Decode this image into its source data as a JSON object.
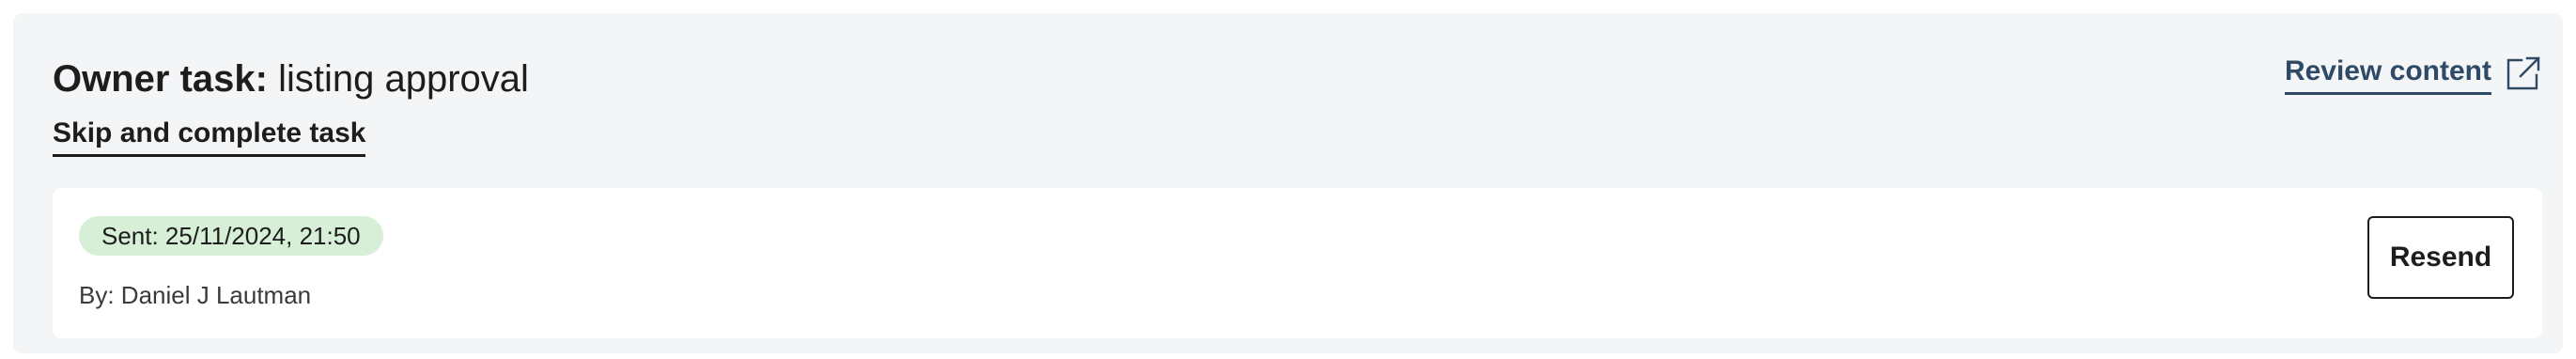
{
  "task": {
    "title_strong": "Owner task:",
    "title_rest": " listing approval",
    "skip_label": "Skip and complete task",
    "review_label": "Review content",
    "review_icon": "external-link-icon"
  },
  "submission": {
    "sent_label": "Sent: 25/11/2024, 21:50",
    "by_label": "By: Daniel J Lautman",
    "resend_label": "Resend",
    "badge_color": "#d6efd6"
  },
  "colors": {
    "panel_bg": "#f4f5f7",
    "link_accent": "#2e4a66",
    "text": "#1d1d1d"
  }
}
